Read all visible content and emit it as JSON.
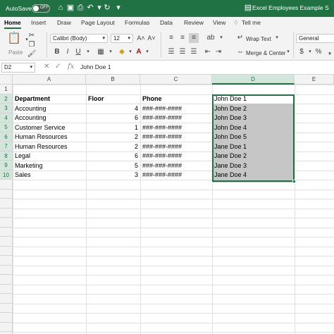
{
  "titlebar": {
    "autosave_label": "AutoSave",
    "autosave_state": "OFF",
    "doc_title": "Excel Employees Example S"
  },
  "ribbon_tabs": [
    "Home",
    "Insert",
    "Draw",
    "Page Layout",
    "Formulas",
    "Data",
    "Review",
    "View",
    "Tell me"
  ],
  "ribbon": {
    "paste_label": "Paste",
    "font_name": "Calibri (Body)",
    "font_size": "12",
    "wrap_text": "Wrap Text",
    "merge_center": "Merge & Center",
    "number_format": "General"
  },
  "formula_bar": {
    "name_box": "D2",
    "fx": "fx",
    "value": "John Doe 1"
  },
  "columns": [
    "A",
    "B",
    "C",
    "D",
    "E"
  ],
  "rows": [
    "1",
    "2",
    "3",
    "4",
    "5",
    "6",
    "7",
    "8",
    "9",
    "10"
  ],
  "sheet": {
    "headers": {
      "department": "Department",
      "floor": "Floor",
      "phone": "Phone",
      "name": "John Doe 1"
    },
    "records": [
      {
        "department": "Accounting",
        "floor": "4",
        "phone": "###-###-####",
        "name": "John Doe 2"
      },
      {
        "department": "Accounting",
        "floor": "6",
        "phone": "###-###-####",
        "name": "John Doe 3"
      },
      {
        "department": "Customer Service",
        "floor": "1",
        "phone": "###-###-####",
        "name": "John Doe 4"
      },
      {
        "department": "Human Resources",
        "floor": "2",
        "phone": "###-###-####",
        "name": "John Doe 5"
      },
      {
        "department": "Human Resources",
        "floor": "2",
        "phone": "###-###-####",
        "name": "Jane Doe 1"
      },
      {
        "department": "Legal",
        "floor": "6",
        "phone": "###-###-####",
        "name": "Jane Doe 2"
      },
      {
        "department": "Marketing",
        "floor": "5",
        "phone": "###-###-####",
        "name": "Jane Doe 3"
      },
      {
        "department": "Sales",
        "floor": "3",
        "phone": "###-###-####",
        "name": "Jane Doe 4"
      }
    ]
  },
  "colors": {
    "accent": "#207245",
    "selection_fill": "#c6c6c6"
  }
}
